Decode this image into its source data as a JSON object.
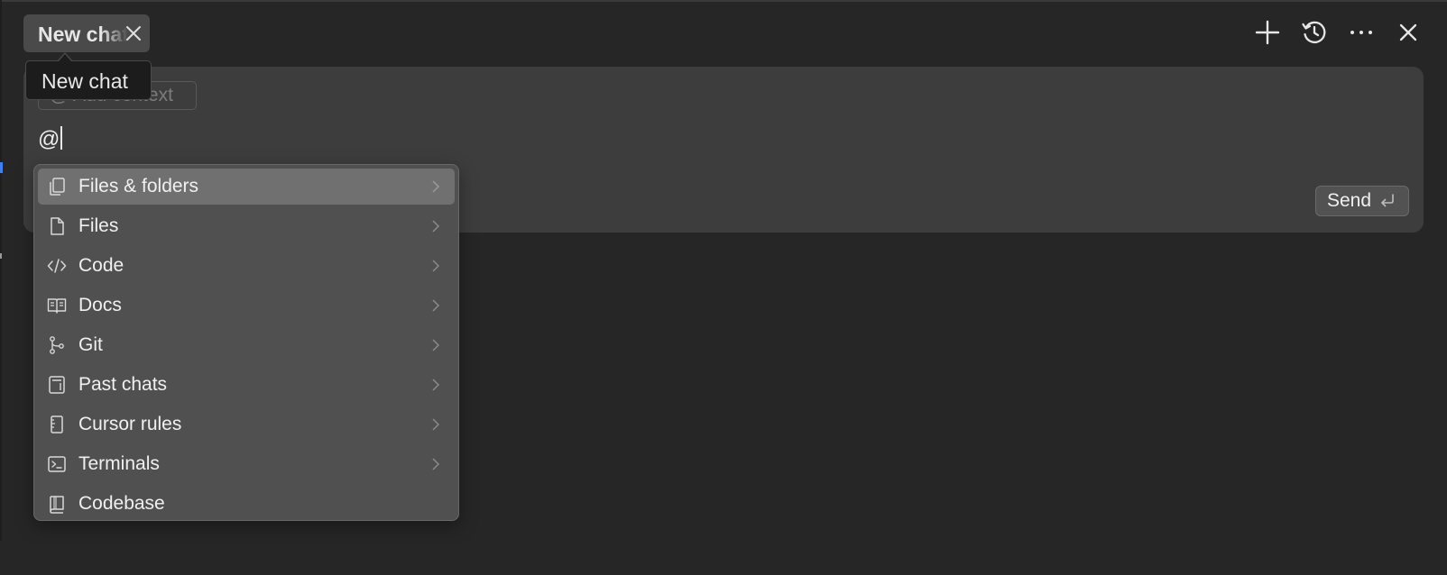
{
  "tab": {
    "title": "New chat"
  },
  "tooltip": {
    "text": "New chat"
  },
  "header_actions": [
    {
      "name": "new-chat-icon"
    },
    {
      "name": "history-icon"
    },
    {
      "name": "more-icon"
    },
    {
      "name": "close-panel-icon"
    }
  ],
  "composer": {
    "add_context_label": "Add context",
    "add_context_icon": "@",
    "input_value": "@",
    "send_label": "Send"
  },
  "menu": {
    "items": [
      {
        "label": "Files & folders",
        "icon": "files-folders-icon",
        "has_submenu": true,
        "active": true
      },
      {
        "label": "Files",
        "icon": "file-icon",
        "has_submenu": true
      },
      {
        "label": "Code",
        "icon": "code-icon",
        "has_submenu": true
      },
      {
        "label": "Docs",
        "icon": "docs-book-icon",
        "has_submenu": true
      },
      {
        "label": "Git",
        "icon": "git-branch-icon",
        "has_submenu": true
      },
      {
        "label": "Past chats",
        "icon": "past-chats-icon",
        "has_submenu": true
      },
      {
        "label": "Cursor rules",
        "icon": "cursor-rules-icon",
        "has_submenu": true
      },
      {
        "label": "Terminals",
        "icon": "terminal-icon",
        "has_submenu": true
      },
      {
        "label": "Codebase",
        "icon": "codebase-icon",
        "has_submenu": false
      }
    ]
  },
  "colors": {
    "background": "#262626",
    "composer": "#3d3d3d",
    "menu": "#505050",
    "menu_active": "#707070",
    "accent_blue": "#3b82f6"
  }
}
